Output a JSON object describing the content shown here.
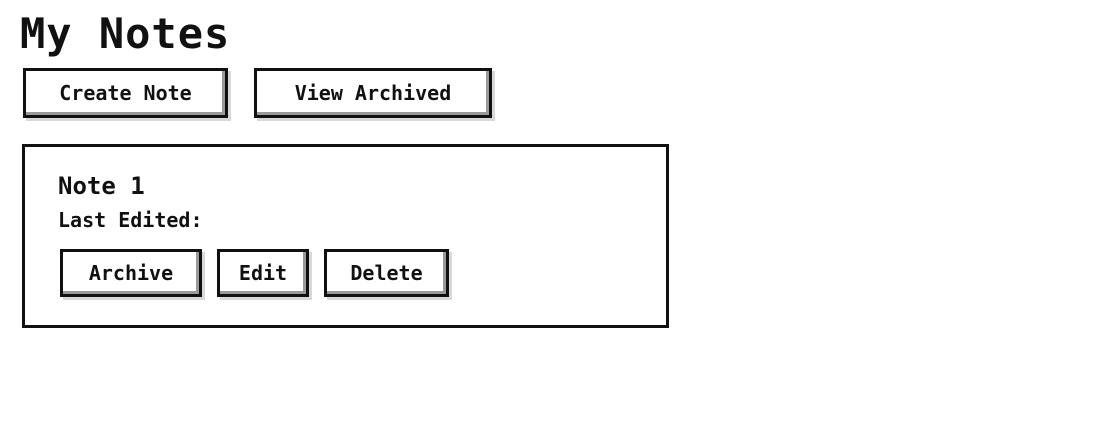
{
  "page": {
    "title": "My Notes"
  },
  "toolbar": {
    "create_label": "Create Note",
    "archived_label": "View Archived"
  },
  "notes": [
    {
      "title": "Note 1",
      "last_edited_label": "Last Edited:",
      "actions": {
        "archive_label": "Archive",
        "edit_label": "Edit",
        "delete_label": "Delete"
      }
    }
  ]
}
